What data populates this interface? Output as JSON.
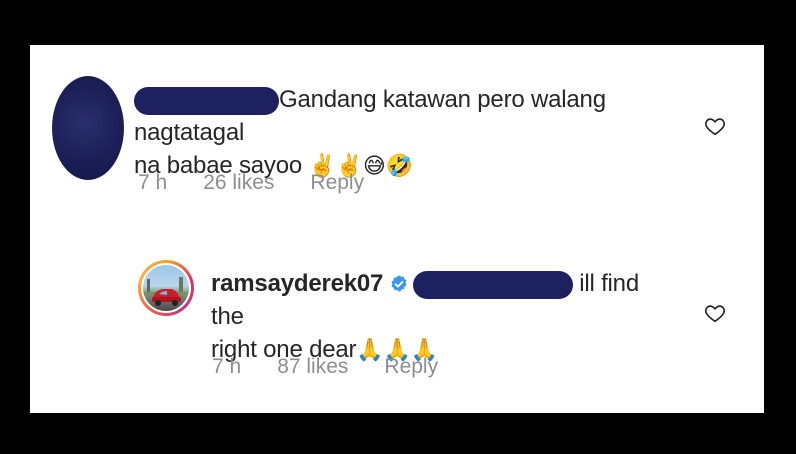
{
  "comment": {
    "text_line1": "Gandang katawan pero walang nagtatagal",
    "text_line2": "na babae sayoo",
    "emojis": "✌️✌️😅🤣",
    "time": "7 h",
    "likes": "26 likes",
    "reply": "Reply",
    "avatar_icon": "redacted-avatar",
    "like_icon": "heart-outline-icon"
  },
  "reply": {
    "username": "ramsayderek07",
    "text_line1": "ill find the",
    "text_line2": "right one dear",
    "emojis": "🙏🙏🙏",
    "time": "7 h",
    "likes": "87 likes",
    "reply": "Reply",
    "avatar_icon": "car-photo-avatar",
    "verified_icon": "verified-badge-icon",
    "like_icon": "heart-outline-icon"
  },
  "colors": {
    "text": "#262626",
    "meta": "#8e8e8e",
    "verified": "#3897f0",
    "redaction": "#1d2160"
  }
}
